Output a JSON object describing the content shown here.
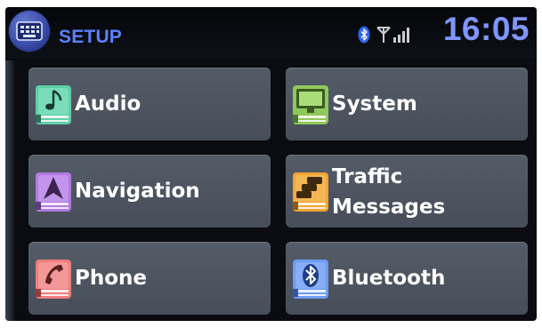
{
  "header": {
    "title": "SETUP",
    "time": "16:05",
    "setup_icon": "keyboard-icon",
    "status_icons": [
      "bluetooth-icon",
      "signal-strength-icon"
    ]
  },
  "menu": {
    "items": [
      {
        "label": "Audio",
        "icon": "music-note-icon",
        "color": "#5fcfa8"
      },
      {
        "label": "System",
        "icon": "monitor-icon",
        "color": "#8fc85a"
      },
      {
        "label": "Navigation",
        "icon": "navigation-arrow-icon",
        "color": "#b27ae2"
      },
      {
        "label": "Traffic Messages",
        "label_line1": "Traffic",
        "label_line2": "Messages",
        "icon": "traffic-jam-icon",
        "color": "#f0a534"
      },
      {
        "label": "Phone",
        "icon": "phone-handset-icon",
        "color": "#f07d7d"
      },
      {
        "label": "Bluetooth",
        "icon": "bluetooth-icon",
        "color": "#6f9cf2"
      }
    ]
  },
  "colors": {
    "background": "#0a0c12",
    "tile": "#4d5560",
    "accent_blue": "#5f80ff"
  }
}
